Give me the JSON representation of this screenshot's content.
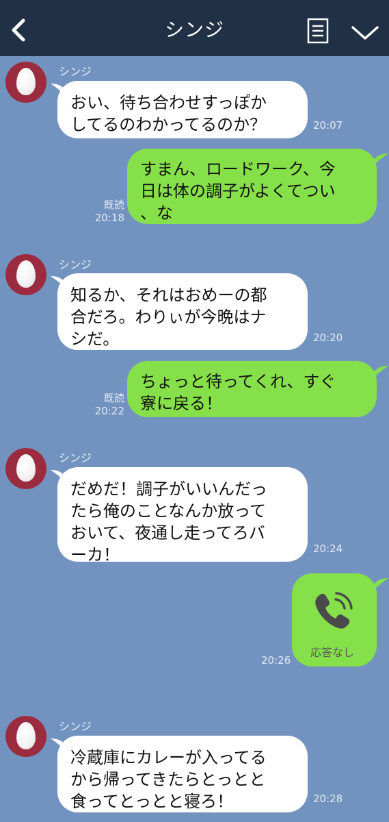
{
  "header": {
    "title": "シンジ",
    "bg": "#213145"
  },
  "contact": {
    "name": "シンジ"
  },
  "colors": {
    "chat_bg": "#7293bf",
    "incoming": "#ffffff",
    "outgoing": "#86e04a",
    "avatar": "#9b2c40"
  },
  "messages": [
    {
      "side": "in",
      "sender": "シンジ",
      "text": "おい、待ち合わせすっぽか\nしてるのわかってるのか？",
      "time": "20:07"
    },
    {
      "side": "out",
      "read": "既読",
      "text": "すまん、ロードワーク、今\n日は体の調子がよくてつい\n、な",
      "time": "20:18"
    },
    {
      "side": "in",
      "sender": "シンジ",
      "text": "知るか、それはおめーの都\n合だろ。わりぃが今晩はナ\nシだ。",
      "time": "20:20"
    },
    {
      "side": "out",
      "read": "既読",
      "text": "ちょっと待ってくれ、すぐ\n寮に戻る！",
      "time": "20:22"
    },
    {
      "side": "in",
      "sender": "シンジ",
      "text": "だめだ！調子がいいんだっ\nたら俺のことなんか放って\nおいて、夜通し走ってろバ\nーカ！",
      "time": "20:24"
    },
    {
      "side": "out",
      "type": "call",
      "icon": "phone-icon",
      "label": "応答なし",
      "time": "20:26"
    },
    {
      "side": "in",
      "sender": "シンジ",
      "text": "冷蔵庫にカレーが入ってる\nから帰ってきたらとっとと\n食ってとっとと寝ろ！",
      "time": "20:28"
    }
  ]
}
